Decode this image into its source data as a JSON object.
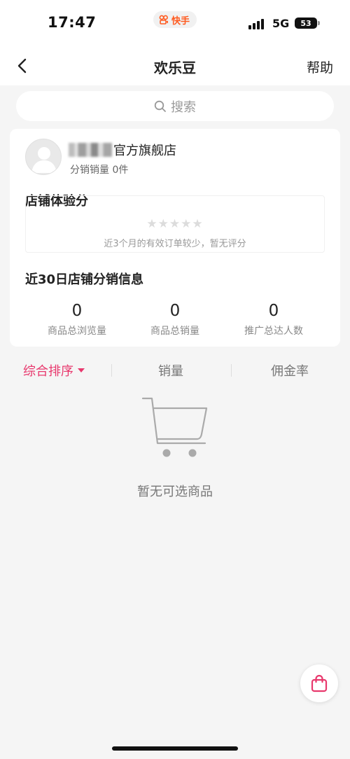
{
  "status_bar": {
    "time": "17:47",
    "app_name": "快手",
    "network": "5G",
    "battery": "53",
    "app_brand_color": "#ff5a1f"
  },
  "nav": {
    "title": "欢乐豆",
    "help_label": "帮助",
    "back_icon": "chevron-left-icon"
  },
  "search": {
    "placeholder": "搜索",
    "icon": "search-icon"
  },
  "store": {
    "name_visible_suffix": "官方旗舰店",
    "sales_text": "分销销量 0件",
    "avatar_icon": "user-avatar-icon"
  },
  "experience_score": {
    "title": "店铺体验分",
    "stars_filled": 0,
    "stars_total": 5,
    "note": "近3个月的有效订单较少，暂无评分"
  },
  "distribution_info": {
    "title": "近30日店铺分销信息",
    "stats": [
      {
        "value": "0",
        "label": "商品总浏览量"
      },
      {
        "value": "0",
        "label": "商品总销量"
      },
      {
        "value": "0",
        "label": "推广总达人数"
      }
    ]
  },
  "sort": {
    "items": [
      {
        "label": "综合排序",
        "active": true
      },
      {
        "label": "销量",
        "active": false
      },
      {
        "label": "佣金率",
        "active": false
      }
    ],
    "active_color": "#e8386d"
  },
  "empty_state": {
    "icon": "shopping-cart-icon",
    "text": "暂无可选商品"
  },
  "floating_button": {
    "icon": "shopping-bag-icon",
    "color": "#e8386d"
  }
}
